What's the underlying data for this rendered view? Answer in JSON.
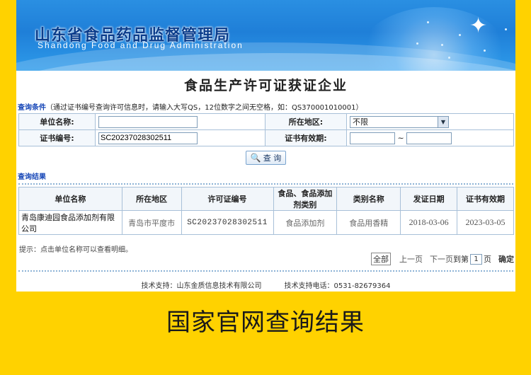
{
  "banner": {
    "title_cn": "山东省食品药品监督管理局",
    "title_en": "Shandong Food and Drug Administration"
  },
  "page_title": "食品生产许可证获证企业",
  "conditions": {
    "link": "查询条件",
    "hint": "（通过证书编号查询许可信息时，请输入大写QS，12位数字之间无空格，如：QS370001010001）"
  },
  "search": {
    "unit_name_label": "单位名称:",
    "unit_name_value": "",
    "region_label": "所在地区:",
    "region_value": "不限",
    "cert_no_label": "证书编号:",
    "cert_no_value": "SC20237028302511",
    "validity_label": "证书有效期:",
    "validity_from": "",
    "validity_sep": "~",
    "validity_to": "",
    "query_button": "查 询"
  },
  "results": {
    "title": "查询结果",
    "columns": [
      "单位名称",
      "所在地区",
      "许可证编号",
      "食品、食品添加剂类别",
      "类别名称",
      "发证日期",
      "证书有效期"
    ],
    "rows": [
      {
        "company": "青岛康迪园食品添加剂有限公司",
        "region": "青岛市平度市",
        "cert_no": "SC20237028302511",
        "food_category": "食品添加剂",
        "category_name": "食品用香精",
        "issue_date": "2018-03-06",
        "valid_until": "2023-03-05"
      }
    ]
  },
  "tip": "提示：点击单位名称可以查看明细。",
  "pager": {
    "all": "全部",
    "prev": "上一页",
    "next": "下一页",
    "goto": "到第",
    "page": "1",
    "page_suffix": "页",
    "confirm": "确定"
  },
  "footer": {
    "support": "技术支持：山东金质信息技术有限公司",
    "phone": "技术支持电话：0531-82679364"
  },
  "caption": "国家官网查询结果"
}
